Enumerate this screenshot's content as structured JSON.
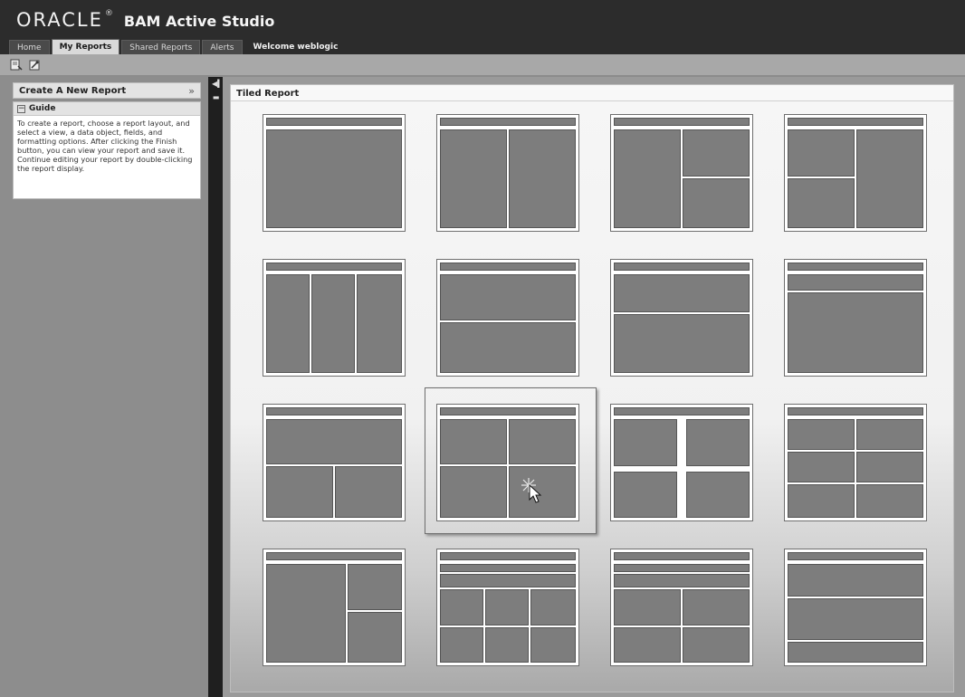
{
  "brand": {
    "oracle": "ORACLE",
    "reg": "®",
    "app": "BAM Active Studio"
  },
  "tabs": [
    {
      "label": "Home",
      "active": false
    },
    {
      "label": "My Reports",
      "active": true
    },
    {
      "label": "Shared Reports",
      "active": false
    },
    {
      "label": "Alerts",
      "active": false
    }
  ],
  "welcome": "Welcome weblogic",
  "toolbar": {
    "icons": [
      "new-report-icon",
      "properties-icon"
    ]
  },
  "left_panel": {
    "create_title": "Create A New Report",
    "collapse_glyph": "»",
    "guide_title": "Guide",
    "guide_toggle": "⊟",
    "guide_text": "To create a report, choose a report layout, and select a view, a data object, fields, and formatting options. After clicking the Finish button, you can view your report and save it. Continue editing your report by double-clicking the report display."
  },
  "main": {
    "panel_title": "Tiled Report",
    "selected_layout": 10
  },
  "colors": {
    "header_bg": "#2c2c2c",
    "cell": "#7d7d7d",
    "panel": "#f1f1f1"
  }
}
